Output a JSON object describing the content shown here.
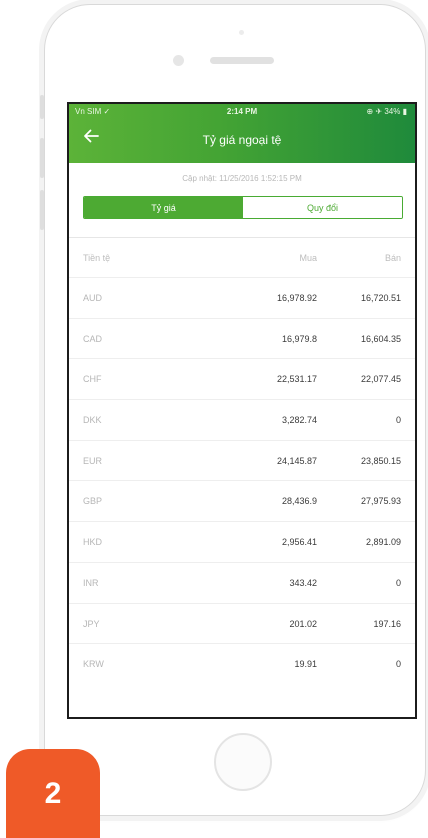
{
  "status_bar": {
    "carrier": "Vn SIM ✓",
    "time": "2:14 PM",
    "battery": "⊕ ✈ 34% ▮"
  },
  "header": {
    "title": "Tỷ giá ngoại tệ",
    "back_icon": "arrow-left-icon"
  },
  "updated_text": "Cập nhật: 11/25/2016 1:52:15 PM",
  "tabs": [
    {
      "label": "Tỷ giá",
      "active": true
    },
    {
      "label": "Quy đổi",
      "active": false
    }
  ],
  "table": {
    "headers": {
      "currency": "Tiền tệ",
      "buy": "Mua",
      "sell": "Bán"
    },
    "rows": [
      {
        "currency": "AUD",
        "buy": "16,978.92",
        "sell": "16,720.51"
      },
      {
        "currency": "CAD",
        "buy": "16,979.8",
        "sell": "16,604.35"
      },
      {
        "currency": "CHF",
        "buy": "22,531.17",
        "sell": "22,077.45"
      },
      {
        "currency": "DKK",
        "buy": "3,282.74",
        "sell": "0"
      },
      {
        "currency": "EUR",
        "buy": "24,145.87",
        "sell": "23,850.15"
      },
      {
        "currency": "GBP",
        "buy": "28,436.9",
        "sell": "27,975.93"
      },
      {
        "currency": "HKD",
        "buy": "2,956.41",
        "sell": "2,891.09"
      },
      {
        "currency": "INR",
        "buy": "343.42",
        "sell": "0"
      },
      {
        "currency": "JPY",
        "buy": "201.02",
        "sell": "197.16"
      },
      {
        "currency": "KRW",
        "buy": "19.91",
        "sell": "0"
      }
    ]
  },
  "step_badge": "2",
  "colors": {
    "accent_green": "#4daa33",
    "header_dark_green": "#1f8a3b",
    "badge_orange": "#ef5a28"
  }
}
